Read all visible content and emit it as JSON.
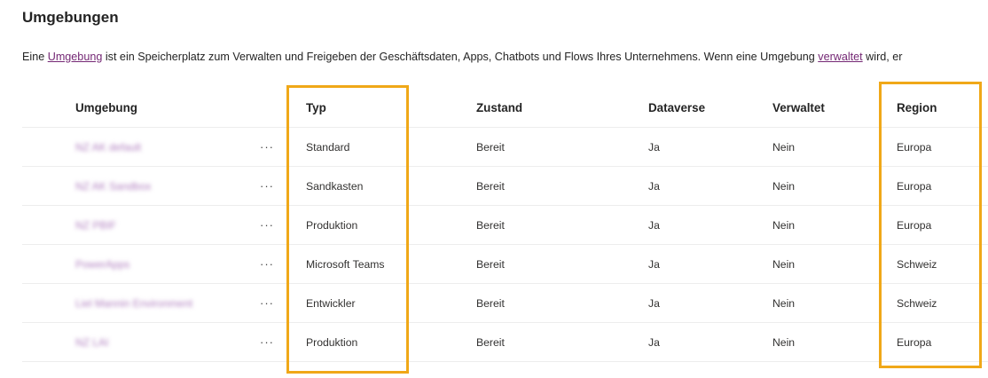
{
  "page": {
    "title": "Umgebungen",
    "description": {
      "part1": "Eine ",
      "link1": "Umgebung",
      "part2": " ist ein Speicherplatz zum Verwalten und Freigeben der Geschäftsdaten, Apps, Chatbots und Flows Ihres Unternehmens. Wenn eine Umgebung ",
      "link2": "verwaltet",
      "part3": " wird, er"
    }
  },
  "table": {
    "headers": {
      "env": "Umgebung",
      "typ": "Typ",
      "state": "Zustand",
      "dataverse": "Dataverse",
      "managed": "Verwaltet",
      "region": "Region"
    },
    "more_label": "···",
    "rows": [
      {
        "name": "NZ AK default",
        "typ": "Standard",
        "state": "Bereit",
        "dataverse": "Ja",
        "managed": "Nein",
        "region": "Europa"
      },
      {
        "name": "NZ AK Sandbox",
        "typ": "Sandkasten",
        "state": "Bereit",
        "dataverse": "Ja",
        "managed": "Nein",
        "region": "Europa"
      },
      {
        "name": "NZ PBIF",
        "typ": "Produktion",
        "state": "Bereit",
        "dataverse": "Ja",
        "managed": "Nein",
        "region": "Europa"
      },
      {
        "name": "PowerApps",
        "typ": "Microsoft Teams",
        "state": "Bereit",
        "dataverse": "Ja",
        "managed": "Nein",
        "region": "Schweiz"
      },
      {
        "name": "Liel Mannin Environment",
        "typ": "Entwickler",
        "state": "Bereit",
        "dataverse": "Ja",
        "managed": "Nein",
        "region": "Schweiz"
      },
      {
        "name": "NZ LAI",
        "typ": "Produktion",
        "state": "Bereit",
        "dataverse": "Ja",
        "managed": "Nein",
        "region": "Europa"
      }
    ]
  },
  "colors": {
    "highlight": "#f0a818",
    "link": "#742774"
  }
}
